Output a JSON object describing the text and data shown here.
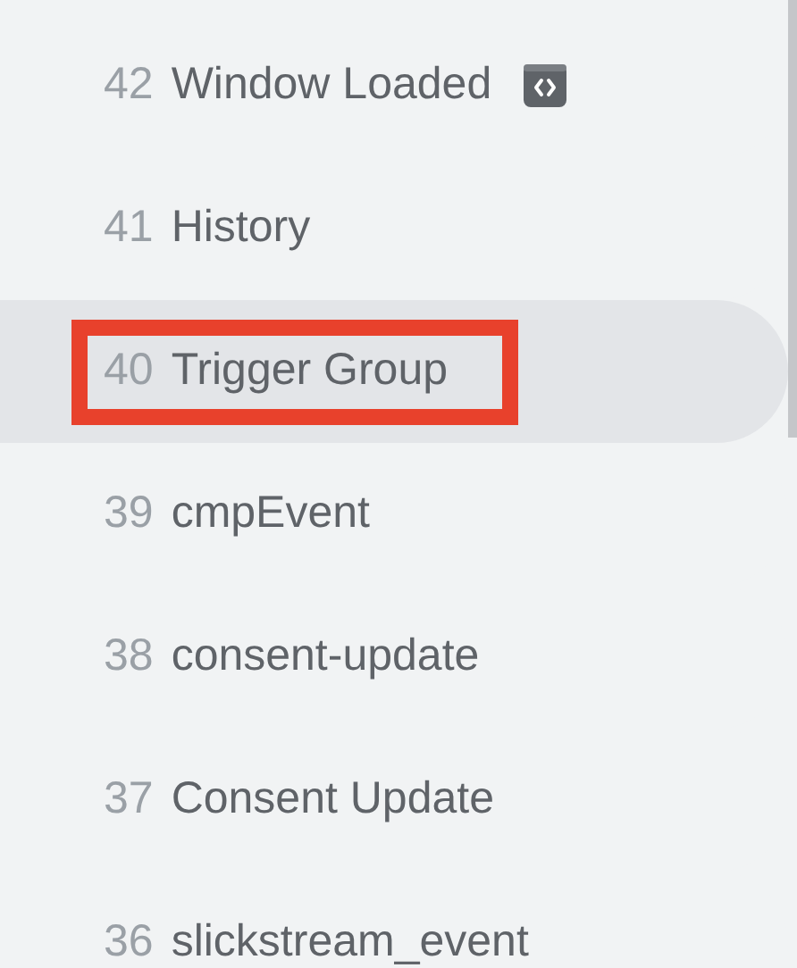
{
  "events": [
    {
      "number": "42",
      "label": "Window Loaded",
      "selected": false,
      "highlighted": false,
      "has_code_badge": true
    },
    {
      "number": "41",
      "label": "History",
      "selected": false,
      "highlighted": false,
      "has_code_badge": false
    },
    {
      "number": "40",
      "label": "Trigger Group",
      "selected": true,
      "highlighted": true,
      "has_code_badge": false
    },
    {
      "number": "39",
      "label": "cmpEvent",
      "selected": false,
      "highlighted": false,
      "has_code_badge": false
    },
    {
      "number": "38",
      "label": "consent-update",
      "selected": false,
      "highlighted": false,
      "has_code_badge": false
    },
    {
      "number": "37",
      "label": "Consent Update",
      "selected": false,
      "highlighted": false,
      "has_code_badge": false
    },
    {
      "number": "36",
      "label": "slickstream_event",
      "selected": false,
      "highlighted": false,
      "has_code_badge": false
    }
  ]
}
